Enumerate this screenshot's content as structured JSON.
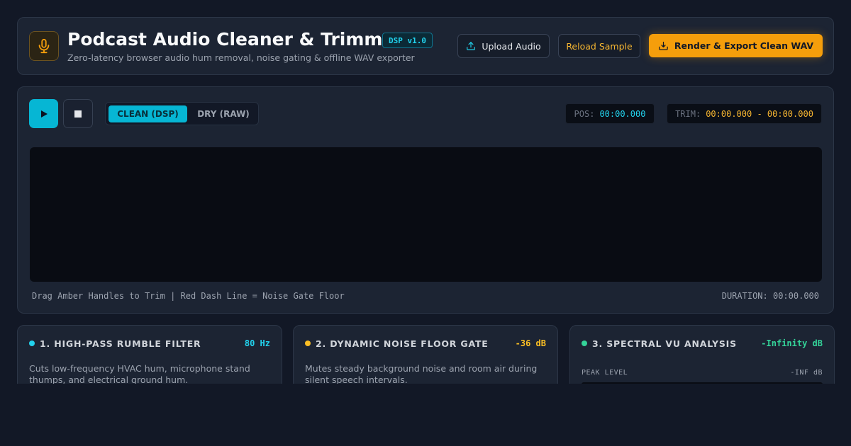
{
  "header": {
    "title": "Podcast Audio Cleaner & Trimmer",
    "badge": "DSP v1.0",
    "subtitle": "Zero-latency browser audio hum removal, noise gating & offline WAV exporter",
    "upload_label": "Upload Audio",
    "reload_label": "Reload Sample",
    "export_label": "Render & Export Clean WAV",
    "logo_icon": "microphone-icon"
  },
  "player": {
    "mode_clean": "CLEAN (DSP)",
    "mode_dry": "DRY (RAW)",
    "pos_label": "POS:",
    "pos_value": "00:00.000",
    "trim_label": "TRIM:",
    "trim_value": "00:00.000 - 00:00.000",
    "hint": "Drag Amber Handles to Trim | Red Dash Line = Noise Gate Floor",
    "duration": "DURATION: 00:00.000"
  },
  "cards": [
    {
      "title": "1. HIGH-PASS RUMBLE FILTER",
      "value": "80 Hz",
      "color": "#22d3ee",
      "desc": "Cuts low-frequency HVAC hum, microphone stand thumps, and electrical ground hum."
    },
    {
      "title": "2. DYNAMIC NOISE FLOOR GATE",
      "value": "-36 dB",
      "color": "#fbbf24",
      "desc": "Mutes steady background noise and room air during silent speech intervals."
    },
    {
      "title": "3. SPECTRAL VU ANALYSIS",
      "value": "-Infinity dB",
      "color": "#34d399",
      "peak_label": "PEAK LEVEL",
      "peak_value": "-INF dB"
    }
  ],
  "colors": {
    "accent": "#06b6d4",
    "amber": "#f59e0b",
    "background": "#121826"
  }
}
